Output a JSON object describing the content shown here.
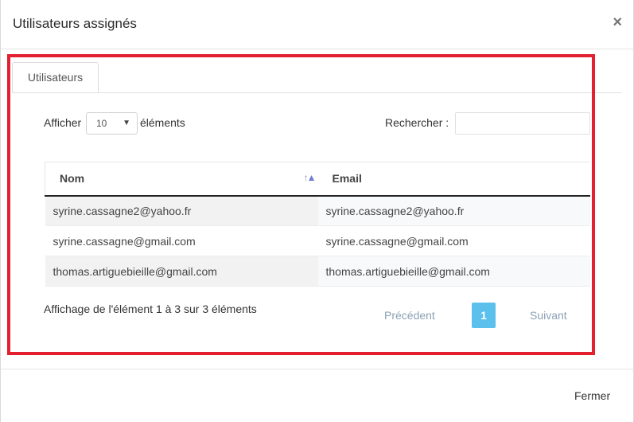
{
  "modal": {
    "title": "Utilisateurs assignés",
    "close_icon": "close-icon",
    "close_glyph": "×",
    "footer_close_label": "Fermer"
  },
  "tabs": [
    {
      "label": "Utilisateurs",
      "active": true
    }
  ],
  "controls": {
    "length_prefix": "Afficher",
    "length_value": "10",
    "length_suffix": "éléments",
    "search_label": "Rechercher :",
    "search_value": ""
  },
  "table": {
    "columns": [
      {
        "label": "Nom",
        "sorted": "ascending"
      },
      {
        "label": "Email"
      }
    ],
    "rows": [
      {
        "nom": "syrine.cassagne2@yahoo.fr",
        "email": "syrine.cassagne2@yahoo.fr"
      },
      {
        "nom": "syrine.cassagne@gmail.com",
        "email": "syrine.cassagne@gmail.com"
      },
      {
        "nom": "thomas.artiguebieille@gmail.com",
        "email": "thomas.artiguebieille@gmail.com"
      }
    ]
  },
  "pagination": {
    "info": "Affichage de l'élément 1 à 3 sur 3 éléments",
    "previous": "Précédent",
    "current_page": "1",
    "next": "Suivant"
  },
  "colors": {
    "highlight_border": "#e2202f",
    "active_page": "#5bc0eb"
  }
}
